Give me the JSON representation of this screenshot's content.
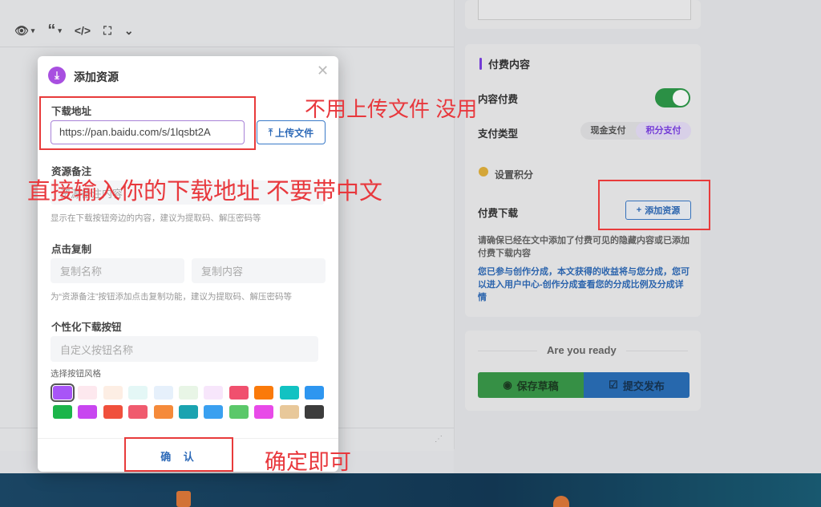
{
  "toolbar": {
    "items": [
      "eye-icon",
      "quote-icon",
      "code-icon",
      "expand-icon",
      "chevron-down-icon"
    ]
  },
  "sidebar": {
    "pay_section_title": "付费内容",
    "content_pay_label": "内容付费",
    "pay_type_label": "支付类型",
    "pay_options": [
      "现金支付",
      "积分支付"
    ],
    "pay_selected": "积分支付",
    "points_label": "设置积分",
    "paid_download_label": "付费下载",
    "add_resource_button": "添加资源",
    "hint_gray": "请确保已经在文中添加了付费可见的隐藏内容或已添加付费下载内容",
    "hint_blue": "您已参与创作分成，本文获得的收益将与您分成，您可以进入用户中心-创作分成查看您的分成比例及分成详情",
    "ready_text": "Are you ready",
    "save_draft_button": "保存草稿",
    "submit_button": "提交发布"
  },
  "modal": {
    "title": "添加资源",
    "download_url_label": "下载地址",
    "download_url_value": "https://pan.baidu.com/s/1lqsbt2A",
    "upload_button": "上传文件",
    "note_label": "资源备注",
    "note_placeholder": "资源备注内容",
    "note_hint": "显示在下载按钮旁边的内容，建议为提取码、解压密码等",
    "copy_label": "点击复制",
    "copy_name_placeholder": "复制名称",
    "copy_content_placeholder": "复制内容",
    "copy_hint": "为“资源备注”按钮添加点击复制功能，建议为提取码、解压密码等",
    "custom_button_label": "个性化下载按钮",
    "custom_button_placeholder": "自定义按钮名称",
    "style_label": "选择按钮风格",
    "confirm_button": "确 认",
    "swatch_colors": [
      "#a855f7",
      "#fde8ee",
      "#fdeee4",
      "#e4f7f6",
      "#e6f0fb",
      "#e8f5e6",
      "#f7e6fb",
      "#f0506e",
      "#fa7a0a",
      "#12c2c2",
      "#2e96f0",
      "#1cb54a",
      "#c846f0",
      "#f0503c",
      "#f05a6e",
      "#f58a3a",
      "#1aa3b0",
      "#3aa0f0",
      "#5bc86a",
      "#e84ae8",
      "#e8c89a",
      "#3c3c3c"
    ]
  },
  "annotations": {
    "no_upload": "不用上传文件 没用",
    "direct_input": "直接输入你的下载地址 不要带中文",
    "just_confirm": "确定即可"
  }
}
